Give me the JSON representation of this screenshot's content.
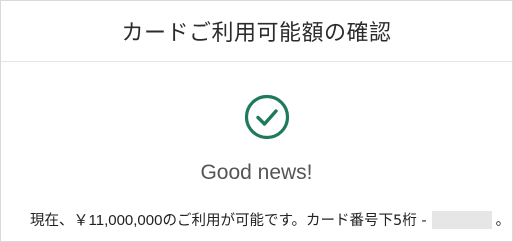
{
  "header": {
    "title": "カードご利用可能額の確認"
  },
  "status": {
    "icon": "check-circle-icon",
    "color": "#1f7a5a",
    "headline": "Good news!"
  },
  "message": {
    "prefix": "現在、",
    "amount": "￥11,000,000",
    "middle": "のご利用が可能です。カード番号下5桁 -",
    "suffix": "。"
  }
}
